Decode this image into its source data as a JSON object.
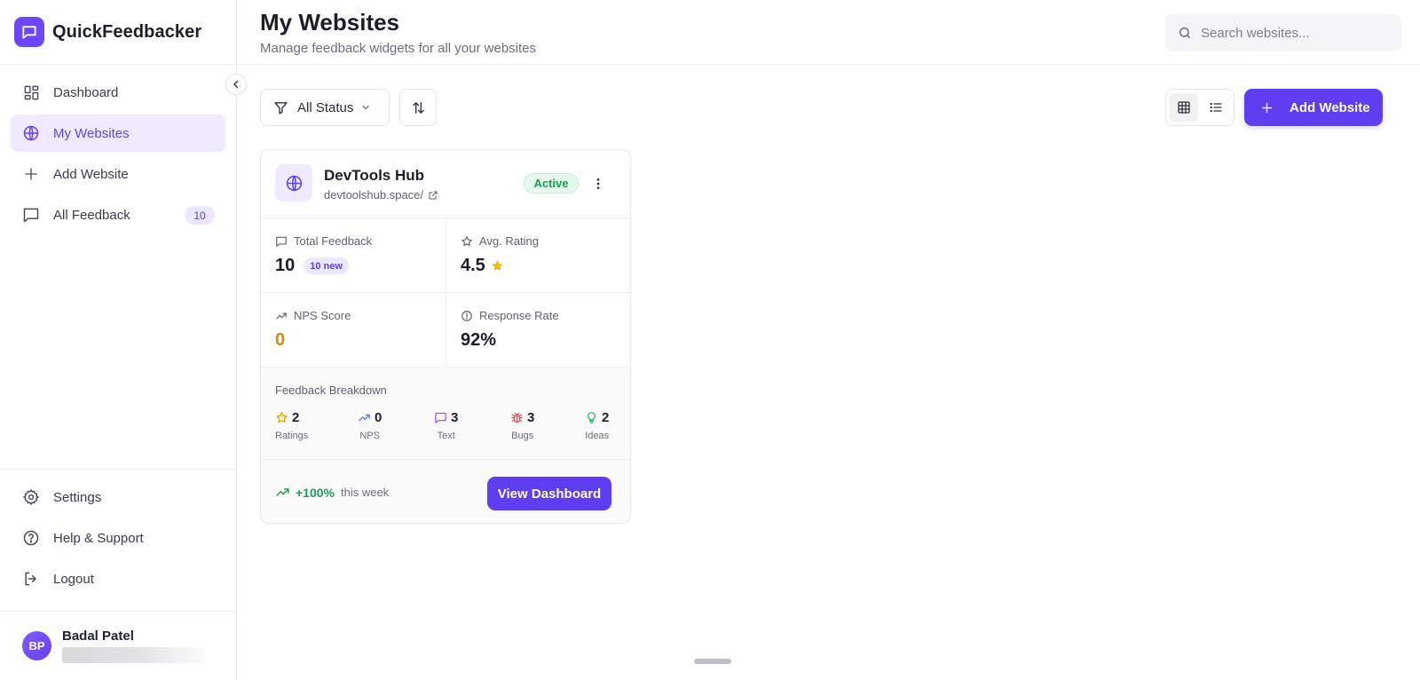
{
  "brand": {
    "name": "QuickFeedbacker",
    "color": "#6c47ff"
  },
  "sidebar": {
    "items": [
      {
        "label": "Dashboard",
        "icon": "dashboard-grid-icon"
      },
      {
        "label": "My Websites",
        "icon": "globe-icon",
        "active": true
      },
      {
        "label": "Add Website",
        "icon": "plus-icon"
      },
      {
        "label": "All Feedback",
        "icon": "message-square-icon",
        "badge": "10"
      }
    ],
    "bottom_items": [
      {
        "label": "Settings",
        "icon": "gear-icon"
      },
      {
        "label": "Help & Support",
        "icon": "help-circle-icon"
      },
      {
        "label": "Logout",
        "icon": "logout-icon"
      }
    ],
    "user": {
      "initials": "BP",
      "name": "Badal Patel"
    }
  },
  "header": {
    "title": "My Websites",
    "subtitle": "Manage feedback widgets for all your websites",
    "search_placeholder": "Search websites..."
  },
  "toolbar": {
    "filter_label": "All Status",
    "add_label": "Add Website"
  },
  "card": {
    "site_name": "DevTools Hub",
    "site_url": "devtoolshub.space/",
    "status": "Active",
    "stats": {
      "total_feedback": {
        "label": "Total Feedback",
        "value": "10",
        "new_pill": "10 new"
      },
      "avg_rating": {
        "label": "Avg. Rating",
        "value": "4.5"
      },
      "nps_score": {
        "label": "NPS Score",
        "value": "0"
      },
      "response_rate": {
        "label": "Response Rate",
        "value": "92%"
      }
    },
    "breakdown": {
      "title": "Feedback Breakdown",
      "items": [
        {
          "label": "Ratings",
          "count": "2",
          "icon": "star-icon",
          "color": "#e0a100"
        },
        {
          "label": "NPS",
          "count": "0",
          "icon": "trend-up-icon",
          "color": "#4f7bf0"
        },
        {
          "label": "Text",
          "count": "3",
          "icon": "message-square-icon",
          "color": "#a24ff0"
        },
        {
          "label": "Bugs",
          "count": "3",
          "icon": "bug-icon",
          "color": "#e5484d"
        },
        {
          "label": "Ideas",
          "count": "2",
          "icon": "lightbulb-icon",
          "color": "#22b35e"
        }
      ]
    },
    "trend": {
      "percent": "+100%",
      "suffix": "this week"
    },
    "view_button": "View Dashboard"
  },
  "colors": {
    "accent": "#5f3df0",
    "success": "#1f9d55",
    "warning": "#d98a0a"
  }
}
